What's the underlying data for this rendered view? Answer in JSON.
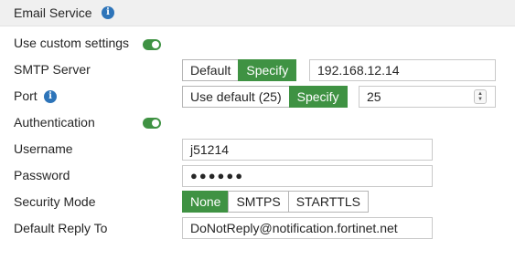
{
  "section": {
    "title": "Email Service"
  },
  "custom_settings": {
    "label": "Use custom settings",
    "enabled": true
  },
  "smtp_server": {
    "label": "SMTP Server",
    "options": [
      "Default",
      "Specify"
    ],
    "selected": "Specify",
    "value": "192.168.12.14"
  },
  "port": {
    "label": "Port",
    "options": [
      "Use default (25)",
      "Specify"
    ],
    "selected": "Specify",
    "value": "25"
  },
  "authentication": {
    "label": "Authentication",
    "enabled": true
  },
  "username": {
    "label": "Username",
    "value": "j51214"
  },
  "password": {
    "label": "Password",
    "value": "●●●●●●"
  },
  "security_mode": {
    "label": "Security Mode",
    "options": [
      "None",
      "SMTPS",
      "STARTTLS"
    ],
    "selected": "None"
  },
  "default_reply_to": {
    "label": "Default Reply To",
    "value": "DoNotReply@notification.fortinet.net"
  },
  "colors": {
    "accent": "#3f9243",
    "info": "#2d74b9",
    "header_bg": "#f0f0f0"
  },
  "icons": {
    "info": "info-icon",
    "toggle": "toggle-switch",
    "stepper": "stepper-arrows"
  }
}
